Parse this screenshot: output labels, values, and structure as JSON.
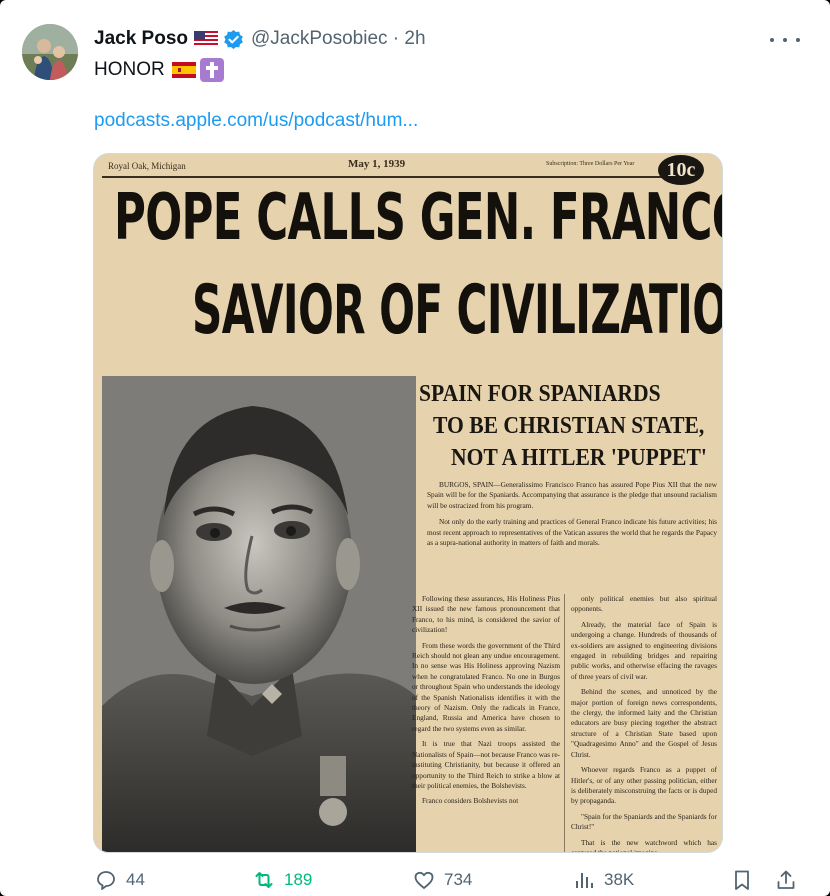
{
  "tweet": {
    "author_name": "Jack Poso",
    "handle_time": "@JackPosobiec · 2h",
    "text": "HONOR",
    "link_text": "podcasts.apple.com/us/podcast/hum...",
    "icons": {
      "flag_us": "us-flag-emoji",
      "verified": "verified-badge",
      "flag_es": "spain-flag-emoji",
      "cross": "latin-cross-emoji",
      "more": "more-horizontal-icon"
    }
  },
  "newspaper": {
    "dateline_left": "Royal Oak, Michigan",
    "date": "May 1, 1939",
    "subscription": "Subscription: Three Dollars Per Year",
    "price": "10c",
    "headline_line1": "POPE CALLS GEN. FRANCO",
    "headline_line2": "SAVIOR OF CIVILIZATION",
    "subhead_line1": "SPAIN FOR SPANIARDS",
    "subhead_line2": "TO BE CHRISTIAN STATE,",
    "subhead_line3": "NOT A HITLER 'PUPPET'",
    "intro_p1": "BURGOS, SPAIN—Generalissimo Francisco Franco has assured Pope Pius XII that the new Spain will be for the Spaniards. Accompanying that assurance is the pledge that unsound racialism will be ostracized from his program.",
    "intro_p2": "Not only do the early training and practices of General Franco indicate his future activities; his most recent approach to representatives of the Vatican assures the world that he regards the Papacy as a supra-national authority in matters of faith and morals.",
    "col1_p1": "Following these assurances, His Holiness Pius XII issued the new famous pronouncement that Franco, to his mind, is considered the savior of civilization!",
    "col1_p2": "From these words the government of the Third Reich should not glean any undue encouragement. In no sense was His Holiness approving Nazism when he congratulated Franco. No one in Burgos or throughout Spain who understands the ideology of the Spanish Nationalists identifies it with the theory of Nazism. Only the radicals in France, England, Russia and America have chosen to regard the two systems even as similar.",
    "col1_p3": "It is true that Nazi troops assisted the Nationalists of Spain—not because Franco was re-instituting Christianity, but because it offered an opportunity to the Third Reich to strike a blow at their political enemies, the Bolshevists.",
    "col1_p4": "Franco considers Bolshevists not",
    "col2_p1": "only political enemies but also spiritual opponents.",
    "col2_p2": "Already, the material face of Spain is undergoing a change. Hundreds of thousands of ex-soldiers are assigned to engineering divisions engaged in rebuilding bridges and repairing public works, and otherwise effacing the ravages of three years of civil war.",
    "col2_p3": "Behind the scenes, and unnoticed by the major portion of foreign news correspondents, the clergy, the informed laity and the Christian educators are busy piecing together the abstract structure of a Christian State based upon \"Quadragesimo Anno\" and the Gospel of Jesus Christ.",
    "col2_p4": "Whoever regards Franco as a puppet of Hitler's, or of any other passing politician, either is deliberately misconstruing the facts or is duped by propaganda.",
    "col2_p5": "\"Spain for the Spaniards and the Spaniards for Christ!\"",
    "col2_p6": "That is the new watchword which has captured the national imagina-"
  },
  "actions": {
    "replies": "44",
    "retweets": "189",
    "likes": "734",
    "views": "38K",
    "colors": {
      "default": "#536471",
      "retweet_active": "#00ba7c",
      "link": "#1d9bf0"
    }
  }
}
